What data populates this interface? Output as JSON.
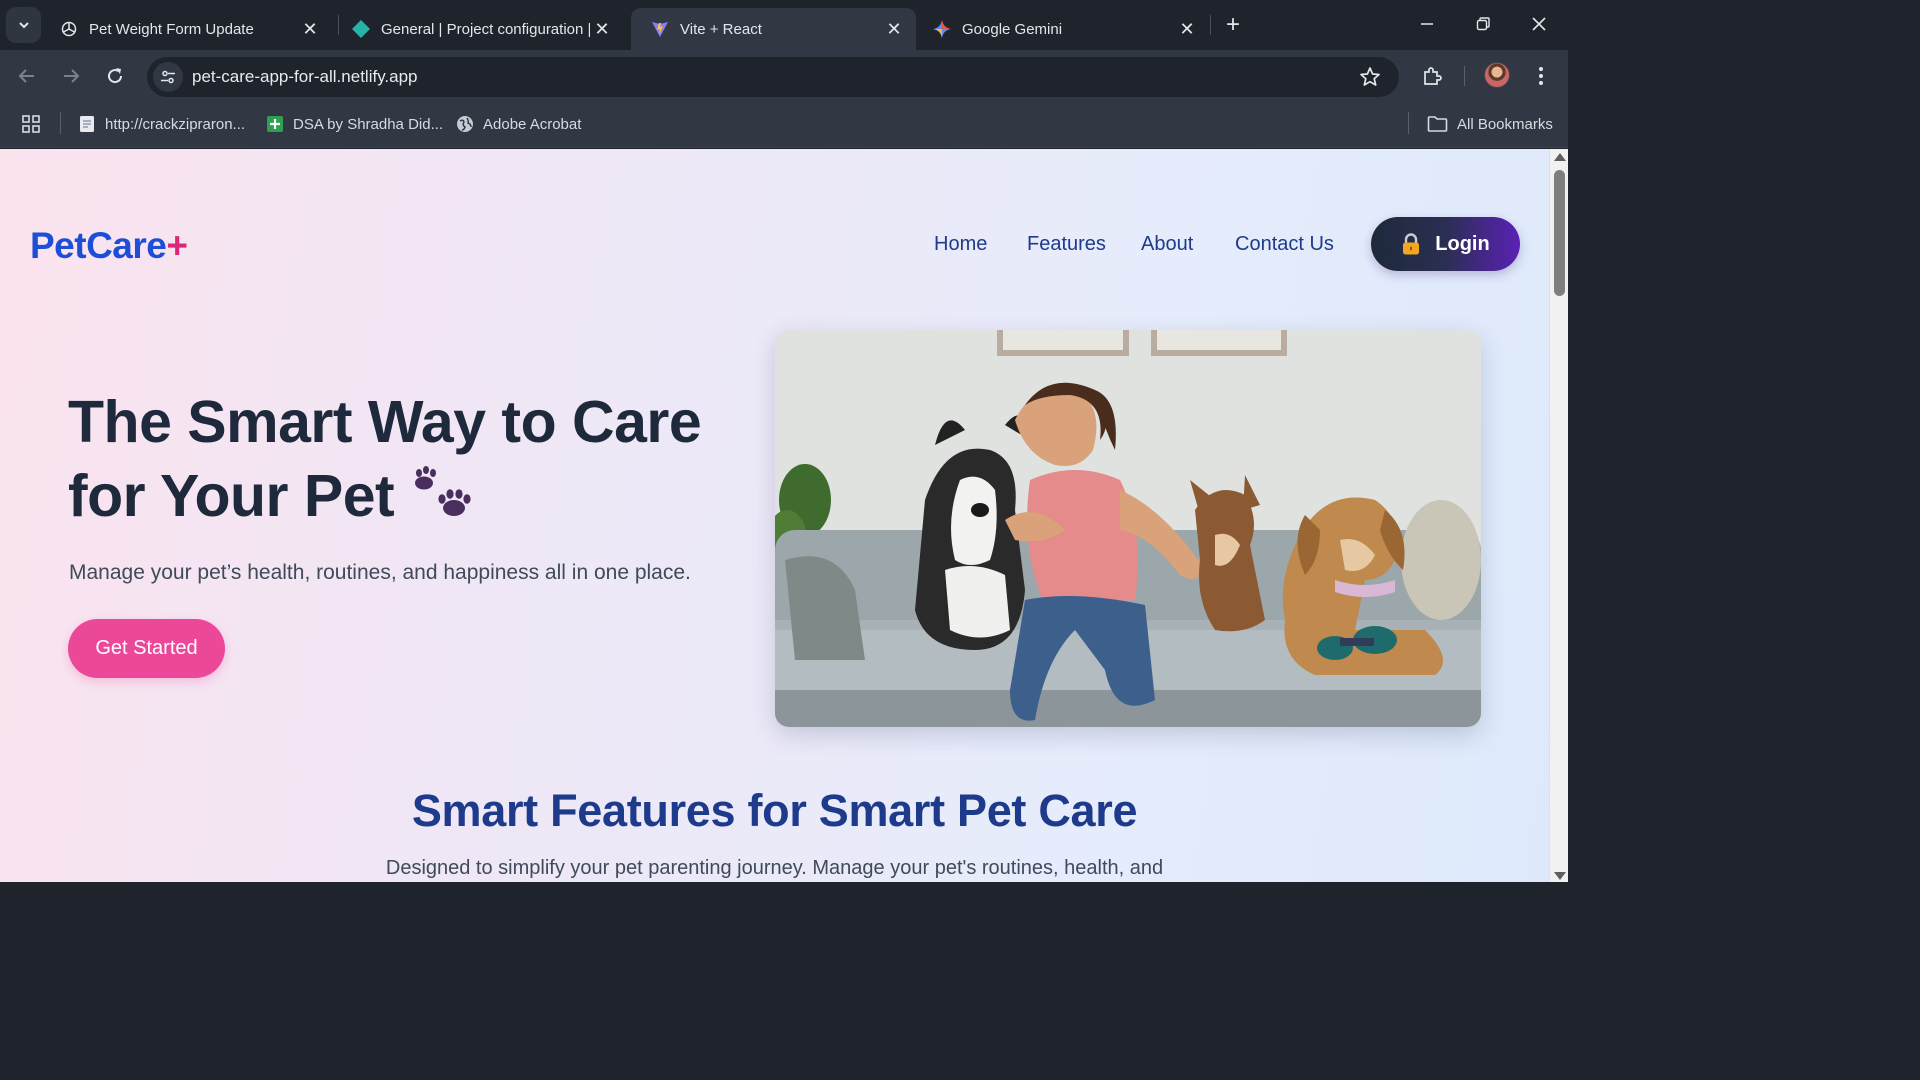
{
  "browser": {
    "tabs": [
      {
        "title": "Pet Weight Form Update",
        "icon": "openai-icon",
        "active": false
      },
      {
        "title": "General | Project configuration |",
        "icon": "netlify-diamond-icon",
        "active": false
      },
      {
        "title": "Vite + React",
        "icon": "vite-icon",
        "active": true
      },
      {
        "title": "Google Gemini",
        "icon": "gemini-sparkle-icon",
        "active": false
      }
    ],
    "url": "pet-care-app-for-all.netlify.app",
    "bookmarks": [
      {
        "label": "http://crackzipraron...",
        "icon": "page-icon"
      },
      {
        "label": "DSA by Shradha Did...",
        "icon": "sheets-plus-icon"
      },
      {
        "label": "Adobe Acrobat",
        "icon": "globe-icon"
      }
    ],
    "all_bookmarks_label": "All Bookmarks"
  },
  "site": {
    "logo_text": "PetCare",
    "logo_plus": "+",
    "nav": [
      "Home",
      "Features",
      "About",
      "Contact Us"
    ],
    "login_label": "Login",
    "hero_title": "The Smart Way to Care for Your Pet",
    "hero_subtitle": "Manage your pet’s health, routines, and happiness all in one place.",
    "cta_label": "Get Started",
    "features_title": "Smart Features for Smart Pet Care",
    "features_subtitle": "Designed to simplify your pet parenting journey. Manage your pet's routines, health, and"
  },
  "colors": {
    "brand_blue": "#1d4ed8",
    "brand_pink": "#ec4899",
    "nav_text": "#1e3a8a",
    "heading_dark": "#1e293b"
  }
}
